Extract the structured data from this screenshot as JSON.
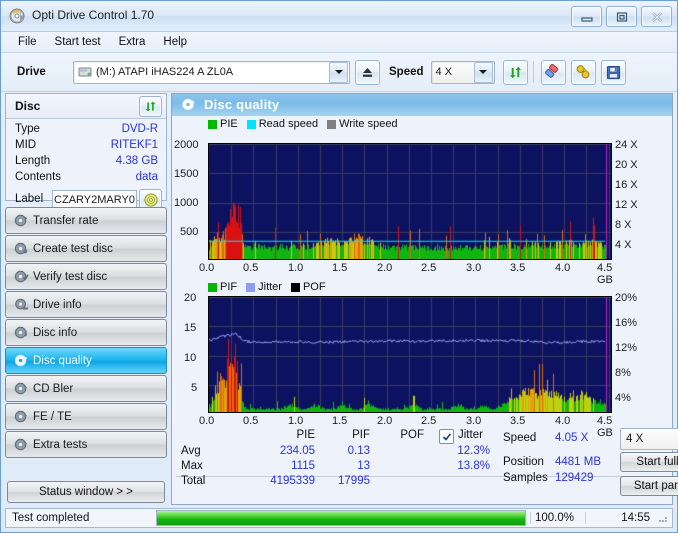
{
  "window": {
    "title": "Opti Drive Control 1.70",
    "icon": "disc-icon",
    "controls": {
      "minimize": "minimize-icon",
      "maximize": "maximize-icon",
      "close": "close-icon"
    }
  },
  "menu": {
    "items": [
      "File",
      "Start test",
      "Extra",
      "Help"
    ]
  },
  "toolbar": {
    "drive_label": "Drive",
    "drive_value": "(M:)   ATAPI iHAS224   A ZL0A",
    "eject_icon": "eject-icon",
    "speed_label": "Speed",
    "speed_value": "4 X",
    "refresh_icon": "refresh-icon",
    "erase_icon": "eraser-icon",
    "plug_icon": "plug-icon",
    "save_icon": "save-icon"
  },
  "disc": {
    "header": "Disc",
    "refresh_icon": "refresh-icon",
    "rows": [
      {
        "key": "Type",
        "value": "DVD-R"
      },
      {
        "key": "MID",
        "value": "RITEKF1"
      },
      {
        "key": "Length",
        "value": "4.38 GB"
      },
      {
        "key": "Contents",
        "value": "data"
      }
    ],
    "label_key": "Label",
    "label_value": "CZARY2MARY0",
    "cd_icon": "cd-icon"
  },
  "nav": {
    "items": [
      {
        "label": "Transfer rate",
        "icon": "disc-speed-icon",
        "active": false
      },
      {
        "label": "Create test disc",
        "icon": "disc-write-icon",
        "active": false
      },
      {
        "label": "Verify test disc",
        "icon": "disc-check-icon",
        "active": false
      },
      {
        "label": "Drive info",
        "icon": "drive-icon",
        "active": false
      },
      {
        "label": "Disc info",
        "icon": "disc-info-icon",
        "active": false
      },
      {
        "label": "Disc quality",
        "icon": "disc-quality-icon",
        "active": true
      },
      {
        "label": "CD Bler",
        "icon": "disc-bler-icon",
        "active": false
      },
      {
        "label": "FE / TE",
        "icon": "disc-fete-icon",
        "active": false
      },
      {
        "label": "Extra tests",
        "icon": "disc-extra-icon",
        "active": false
      }
    ],
    "status_button": "Status window > >"
  },
  "main": {
    "title": "Disc quality",
    "icon": "disc-quality-icon"
  },
  "stats": {
    "columns": [
      "PIE",
      "PIF",
      "POF",
      "Jitter"
    ],
    "jitter_checked": true,
    "rows": [
      {
        "label": "Avg",
        "pie": "234.05",
        "pif": "0.13",
        "pof": "",
        "jitter": "12.3%"
      },
      {
        "label": "Max",
        "pie": "1115",
        "pif": "13",
        "pof": "",
        "jitter": "13.8%"
      },
      {
        "label": "Total",
        "pie": "4195339",
        "pif": "17995",
        "pof": "",
        "jitter": ""
      }
    ],
    "speed_label": "Speed",
    "speed_value": "4.05 X",
    "position_label": "Position",
    "position_value": "4481 MB",
    "samples_label": "Samples",
    "samples_value": "129429",
    "speed_select": "4 X",
    "start_full": "Start full",
    "start_part": "Start part"
  },
  "statusbar": {
    "message": "Test completed",
    "progress": 100.0,
    "progress_text": "100.0%",
    "time": "14:55"
  },
  "chart_data": [
    {
      "type": "area",
      "name": "pie-chart",
      "title": "",
      "xlabel": "GB",
      "ylabel": "",
      "ylim": [
        0,
        2000
      ],
      "xlim": [
        0,
        4.55
      ],
      "y_ticks": [
        500,
        1000,
        1500,
        2000
      ],
      "x_ticks": [
        "0.0",
        "0.5",
        "1.0",
        "1.5",
        "2.0",
        "2.5",
        "3.0",
        "3.5",
        "4.0",
        "4.5 GB"
      ],
      "y2_ticks": [
        "4 X",
        "8 X",
        "12 X",
        "16 X",
        "20 X",
        "24 X"
      ],
      "y2_lim": [
        0,
        24
      ],
      "grid": true,
      "legend": [
        {
          "label": "PIE",
          "color": "#00b800"
        },
        {
          "label": "Read speed",
          "color": "#00e5ff"
        },
        {
          "label": "Write speed",
          "color": "#808080"
        }
      ],
      "series": [
        {
          "name": "PIE",
          "kind": "bars",
          "note": "heavy red spikes 0.0-0.35 GB peaking ~1115, then low green 200-350 across disc with orange/yellow clusters around 1.2-1.8 and 3.4-4.3",
          "x": [
            0.02,
            0.05,
            0.08,
            0.11,
            0.14,
            0.17,
            0.2,
            0.23,
            0.26,
            0.29,
            0.32,
            0.35,
            0.4,
            0.5,
            0.6,
            0.7,
            0.8,
            0.9,
            1.0,
            1.1,
            1.2,
            1.3,
            1.4,
            1.5,
            1.6,
            1.7,
            1.8,
            1.9,
            2.0,
            2.1,
            2.2,
            2.3,
            2.4,
            2.5,
            2.6,
            2.7,
            2.8,
            2.9,
            3.0,
            3.1,
            3.2,
            3.3,
            3.4,
            3.5,
            3.6,
            3.7,
            3.8,
            3.9,
            4.0,
            4.1,
            4.2,
            4.3,
            4.4,
            4.5
          ],
          "values": [
            300,
            420,
            470,
            560,
            620,
            700,
            780,
            900,
            1030,
            1115,
            1000,
            760,
            330,
            300,
            290,
            280,
            300,
            290,
            280,
            300,
            360,
            380,
            420,
            430,
            500,
            470,
            420,
            330,
            300,
            280,
            290,
            280,
            290,
            270,
            280,
            270,
            290,
            280,
            280,
            270,
            280,
            290,
            300,
            320,
            340,
            330,
            320,
            350,
            360,
            370,
            360,
            350,
            340,
            330
          ]
        },
        {
          "name": "Read speed",
          "kind": "line",
          "color": "#00e5ff",
          "note": "flat CAV-ish read speed line at ~4X constant",
          "x": [
            0.0,
            0.5,
            1.0,
            1.5,
            2.0,
            2.5,
            3.0,
            3.5,
            4.0,
            4.5
          ],
          "values": [
            4.05,
            4.05,
            4.05,
            4.05,
            4.05,
            4.05,
            4.05,
            4.05,
            4.05,
            4.05
          ]
        }
      ]
    },
    {
      "type": "area",
      "name": "pif-jitter-chart",
      "title": "",
      "xlabel": "GB",
      "ylabel": "",
      "ylim": [
        0,
        20
      ],
      "xlim": [
        0,
        4.55
      ],
      "y_ticks": [
        5,
        10,
        15,
        20
      ],
      "x_ticks": [
        "0.0",
        "0.5",
        "1.0",
        "1.5",
        "2.0",
        "2.5",
        "3.0",
        "3.5",
        "4.0",
        "4.5 GB"
      ],
      "y2_ticks": [
        "4%",
        "8%",
        "12%",
        "16%",
        "20%"
      ],
      "y2_lim": [
        0,
        20
      ],
      "grid": true,
      "legend": [
        {
          "label": "PIF",
          "color": "#00b800"
        },
        {
          "label": "Jitter",
          "color": "#8e9ef0"
        },
        {
          "label": "POF",
          "color": "#000000"
        }
      ],
      "series": [
        {
          "name": "PIF",
          "kind": "bars",
          "note": "tall red/orange spikes up to 13 in first 0.3 GB, then low green 1-2 across with yellow-green cluster near 3.4-4.3",
          "x": [
            0.02,
            0.05,
            0.08,
            0.11,
            0.14,
            0.17,
            0.2,
            0.23,
            0.26,
            0.29,
            0.32,
            0.4,
            0.5,
            0.6,
            0.7,
            0.8,
            0.9,
            1.0,
            1.1,
            1.2,
            1.3,
            1.4,
            1.5,
            1.6,
            1.7,
            1.8,
            1.9,
            2.0,
            2.1,
            2.2,
            2.3,
            2.4,
            2.5,
            2.6,
            2.7,
            2.8,
            2.9,
            3.0,
            3.1,
            3.2,
            3.3,
            3.4,
            3.5,
            3.6,
            3.7,
            3.8,
            3.9,
            4.0,
            4.1,
            4.2,
            4.3,
            4.4,
            4.5
          ],
          "values": [
            2,
            4,
            6,
            5,
            8,
            6,
            11,
            9,
            13,
            12,
            7,
            1,
            1,
            1,
            1,
            1,
            2,
            1,
            1,
            2,
            1,
            1,
            2,
            1,
            1,
            2,
            1,
            1,
            1,
            1,
            2,
            1,
            1,
            1,
            1,
            2,
            1,
            1,
            2,
            1,
            2,
            3,
            4,
            5,
            4,
            5,
            4,
            3,
            3,
            4,
            3,
            2,
            2
          ]
        },
        {
          "name": "Jitter",
          "kind": "line",
          "color": "#8e9ef0",
          "note": "noisy jitter trace hovering 12-13.8%, slightly higher near 0.2 GB",
          "x": [
            0.0,
            0.1,
            0.2,
            0.3,
            0.4,
            0.6,
            0.8,
            1.0,
            1.2,
            1.4,
            1.6,
            1.8,
            2.0,
            2.2,
            2.4,
            2.6,
            2.8,
            3.0,
            3.2,
            3.4,
            3.6,
            3.8,
            4.0,
            4.2,
            4.4,
            4.5
          ],
          "values": [
            12.6,
            13.0,
            13.4,
            13.8,
            12.4,
            12.3,
            12.3,
            12.3,
            12.3,
            12.3,
            12.4,
            12.4,
            12.4,
            12.5,
            12.4,
            12.5,
            12.5,
            12.6,
            12.5,
            12.5,
            12.5,
            12.2,
            12.3,
            12.4,
            12.4,
            12.2
          ]
        }
      ]
    }
  ]
}
